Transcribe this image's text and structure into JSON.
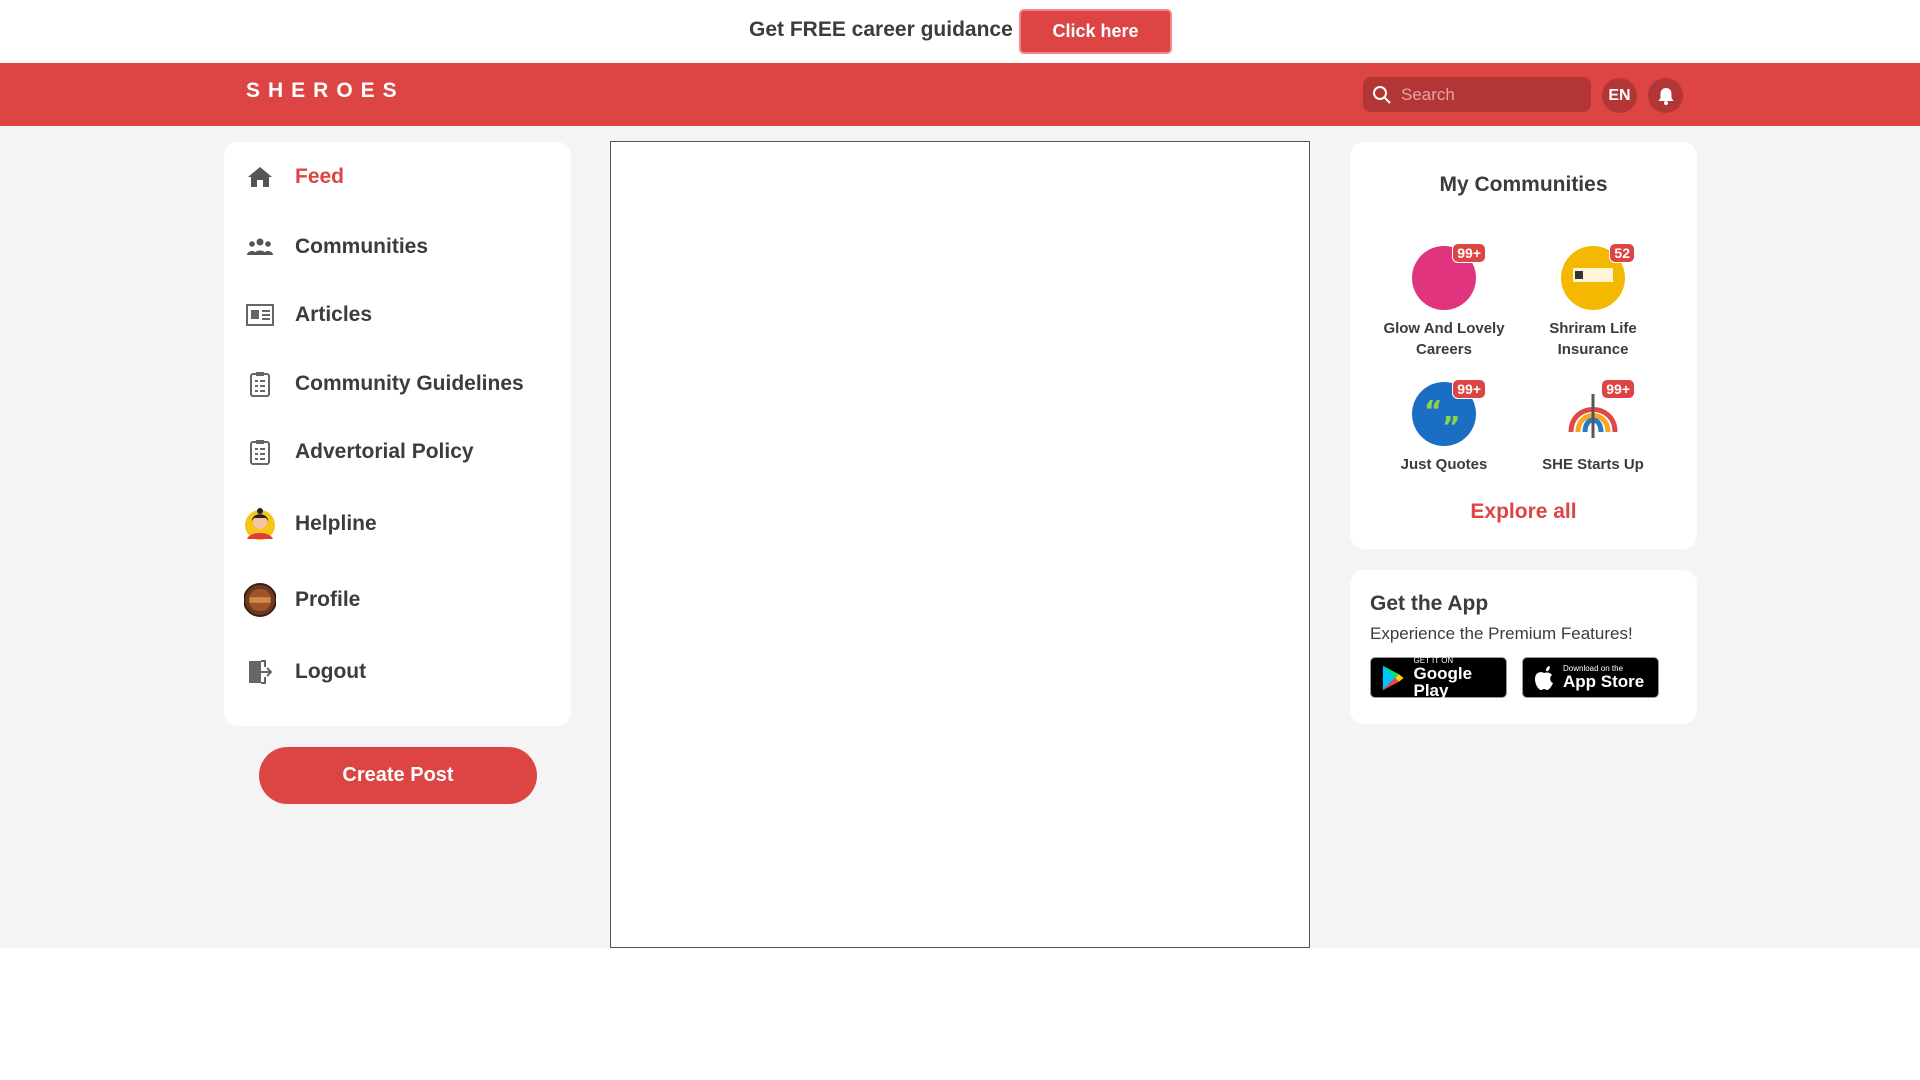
{
  "promo": {
    "text": "Get FREE career guidance",
    "button": "Click here"
  },
  "header": {
    "logo": "SHEROES",
    "search_placeholder": "Search",
    "lang": "EN"
  },
  "sidebar": {
    "items": [
      {
        "label": "Feed",
        "icon": "home-icon",
        "active": true
      },
      {
        "label": "Communities",
        "icon": "people-icon"
      },
      {
        "label": "Articles",
        "icon": "newspaper-icon"
      },
      {
        "label": "Community Guidelines",
        "icon": "clipboard-icon"
      },
      {
        "label": "Advertorial Policy",
        "icon": "clipboard-icon"
      },
      {
        "label": "Helpline",
        "icon": "helpline-avatar-icon"
      },
      {
        "label": "Profile",
        "icon": "profile-avatar"
      },
      {
        "label": "Logout",
        "icon": "logout-icon"
      }
    ],
    "create_post": "Create Post"
  },
  "communities": {
    "title": "My Communities",
    "items": [
      {
        "name_line1": "Glow And Lovely",
        "name_line2": "Careers",
        "badge": "99+",
        "color": "#e0347f"
      },
      {
        "name_line1": "Shriram Life",
        "name_line2": "Insurance",
        "badge": "52",
        "color": "#f5b800"
      },
      {
        "name_line1": "Just Quotes",
        "name_line2": "",
        "badge": "99+",
        "color": "#1a6fc4"
      },
      {
        "name_line1": "SHE Starts Up",
        "name_line2": "",
        "badge": "99+",
        "color": "#ffffff"
      }
    ],
    "explore": "Explore all"
  },
  "app": {
    "title": "Get the App",
    "subtitle": "Experience the Premium Features!",
    "google": {
      "small": "GET IT ON",
      "big": "Google Play"
    },
    "apple": {
      "small": "Download on the",
      "big": "App Store"
    }
  },
  "colors": {
    "brand": "#dd4444",
    "background": "#f4f4f4"
  }
}
